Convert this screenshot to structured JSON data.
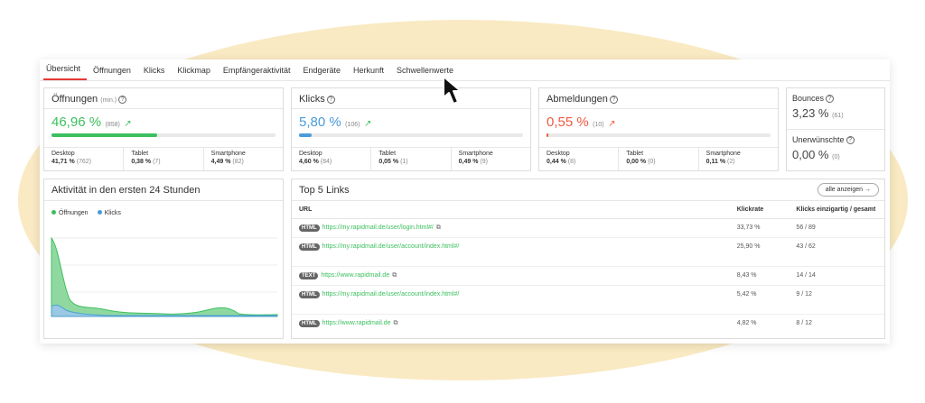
{
  "tabs": [
    "Übersicht",
    "Öffnungen",
    "Klicks",
    "Klickmap",
    "Empfängeraktivität",
    "Endgeräte",
    "Herkunft",
    "Schwellenwerte"
  ],
  "metrics": {
    "opens": {
      "title": "Öffnungen",
      "suffix": "(min.)",
      "value": "46,96 %",
      "count": "(858)",
      "bar_pct": 0.47,
      "devices": [
        {
          "label": "Desktop",
          "value": "41,71 %",
          "count": "(762)"
        },
        {
          "label": "Tablet",
          "value": "0,38 %",
          "count": "(7)"
        },
        {
          "label": "Smartphone",
          "value": "4,49 %",
          "count": "(82)"
        }
      ]
    },
    "clicks": {
      "title": "Klicks",
      "value": "5,80 %",
      "count": "(106)",
      "bar_pct": 0.058,
      "devices": [
        {
          "label": "Desktop",
          "value": "4,60 %",
          "count": "(84)"
        },
        {
          "label": "Tablet",
          "value": "0,05 %",
          "count": "(1)"
        },
        {
          "label": "Smartphone",
          "value": "0,49 %",
          "count": "(9)"
        }
      ]
    },
    "unsubs": {
      "title": "Abmeldungen",
      "value": "0,55 %",
      "count": "(10)",
      "bar_pct": 0.0055,
      "devices": [
        {
          "label": "Desktop",
          "value": "0,44 %",
          "count": "(8)"
        },
        {
          "label": "Tablet",
          "value": "0,00 %",
          "count": "(0)"
        },
        {
          "label": "Smartphone",
          "value": "0,11 %",
          "count": "(2)"
        }
      ]
    }
  },
  "side": {
    "bounces": {
      "label": "Bounces",
      "value": "3,23 %",
      "count": "(61)"
    },
    "unwanted": {
      "label": "Unerwünschte",
      "value": "0,00 %",
      "count": "(0)"
    }
  },
  "activity": {
    "title": "Aktivität in den ersten 24 Stunden",
    "legend_opens": "Öffnungen",
    "legend_clicks": "Klicks"
  },
  "links": {
    "title": "Top 5 Links",
    "button": "alle anzeigen",
    "headers": {
      "url": "URL",
      "rate": "Klickrate",
      "clicks": "Klicks einzigartig / gesamt"
    },
    "rows": [
      {
        "type": "HTML",
        "url": "https://my.rapidmail.de/user/login.html#/",
        "rate": "33,73 %",
        "clicks": "56 / 89"
      },
      {
        "type": "HTML",
        "url": "https://my.rapidmail.de/user/account/index.html#/",
        "rate": "25,90 %",
        "clicks": "43 / 62"
      },
      {
        "type": "TEXT",
        "url": "https://www.rapidmail.de",
        "rate": "8,43 %",
        "clicks": "14 / 14"
      },
      {
        "type": "HTML",
        "url": "https://my.rapidmail.de/user/account/index.html#/",
        "rate": "5,42 %",
        "clicks": "9 / 12"
      },
      {
        "type": "HTML",
        "url": "https://www.rapidmail.de",
        "rate": "4,82 %",
        "clicks": "8 / 12"
      }
    ]
  },
  "colors": {
    "green": "#3cbf5f",
    "blue": "#4a9bd8",
    "red": "#ef5a40",
    "active_tab": "#e53935"
  }
}
